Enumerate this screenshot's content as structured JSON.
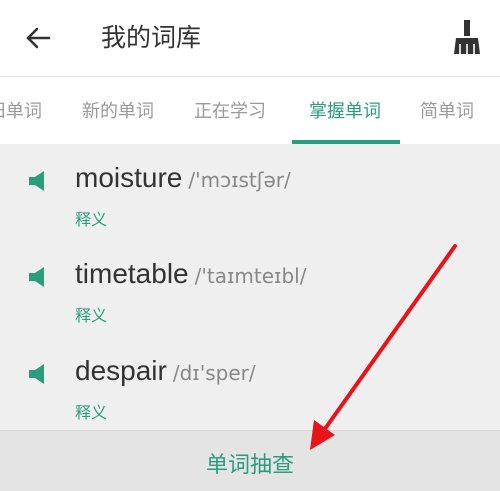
{
  "header": {
    "title": "我的词库",
    "back_icon": "arrow-left-icon",
    "action_icon": "broom-icon"
  },
  "tabs": [
    {
      "label": "旧单词",
      "active": false
    },
    {
      "label": "新的单词",
      "active": false
    },
    {
      "label": "正在学习",
      "active": false
    },
    {
      "label": "掌握单词",
      "active": true
    },
    {
      "label": "简单词",
      "active": false
    }
  ],
  "words": [
    {
      "word": "moisture",
      "phonetic": "/'mɔɪstʃər/",
      "meaning_label": "释义",
      "icon": "speaker-icon"
    },
    {
      "word": "timetable",
      "phonetic": "/'taɪmteɪbl/",
      "meaning_label": "释义",
      "icon": "speaker-icon"
    },
    {
      "word": "despair",
      "phonetic": "/dɪ'sper/",
      "meaning_label": "释义",
      "icon": "speaker-icon"
    }
  ],
  "bottom": {
    "label": "单词抽查"
  },
  "colors": {
    "accent": "#2a9d7c",
    "arrow": "#e8141a",
    "background": "#efefef"
  }
}
